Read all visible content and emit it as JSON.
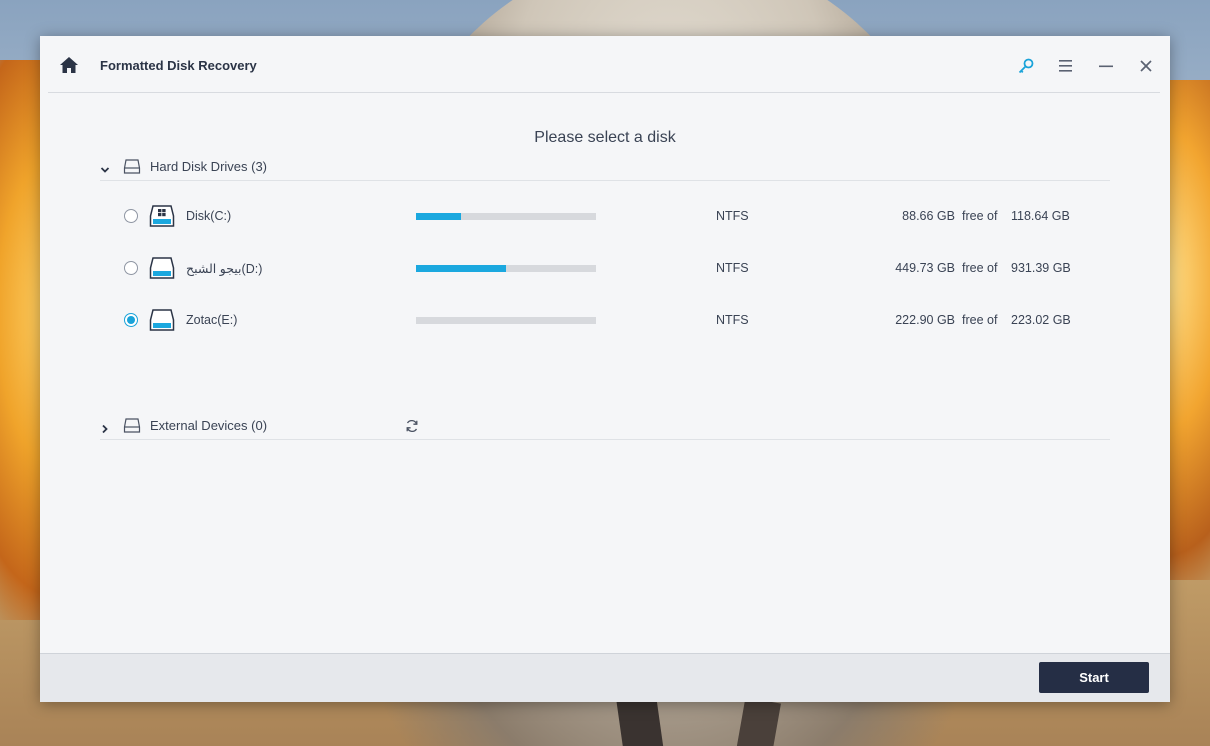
{
  "window": {
    "title": "Formatted Disk Recovery",
    "icons": [
      "home-icon",
      "key-icon",
      "menu-icon",
      "minimize-icon",
      "close-icon"
    ]
  },
  "main": {
    "heading": "Please select a disk"
  },
  "hard_disks": {
    "label": "Hard Disk Drives (3)",
    "expanded": true,
    "drives": [
      {
        "name": "Disk(C:)",
        "icon": "windows-drive-icon",
        "usage_fraction": 0.25,
        "filesystem": "NTFS",
        "free": "88.66 GB",
        "free_of": "free of",
        "total": "118.64 GB",
        "selected": false
      },
      {
        "name": "بيجو الشبح(D:)",
        "icon": "drive-icon",
        "usage_fraction": 0.5,
        "filesystem": "NTFS",
        "free": "449.73 GB",
        "free_of": "free of",
        "total": "931.39 GB",
        "selected": false
      },
      {
        "name": "Zotac(E:)",
        "icon": "drive-icon",
        "usage_fraction": 0.0,
        "filesystem": "NTFS",
        "free": "222.90 GB",
        "free_of": "free of",
        "total": "223.02 GB",
        "selected": true
      }
    ]
  },
  "external": {
    "label": "External Devices (0)",
    "expanded": false
  },
  "footer": {
    "start_label": "Start"
  },
  "colors": {
    "accent": "#1ba8df",
    "primary_button": "#252e45",
    "window_bg": "#f5f6f8"
  }
}
